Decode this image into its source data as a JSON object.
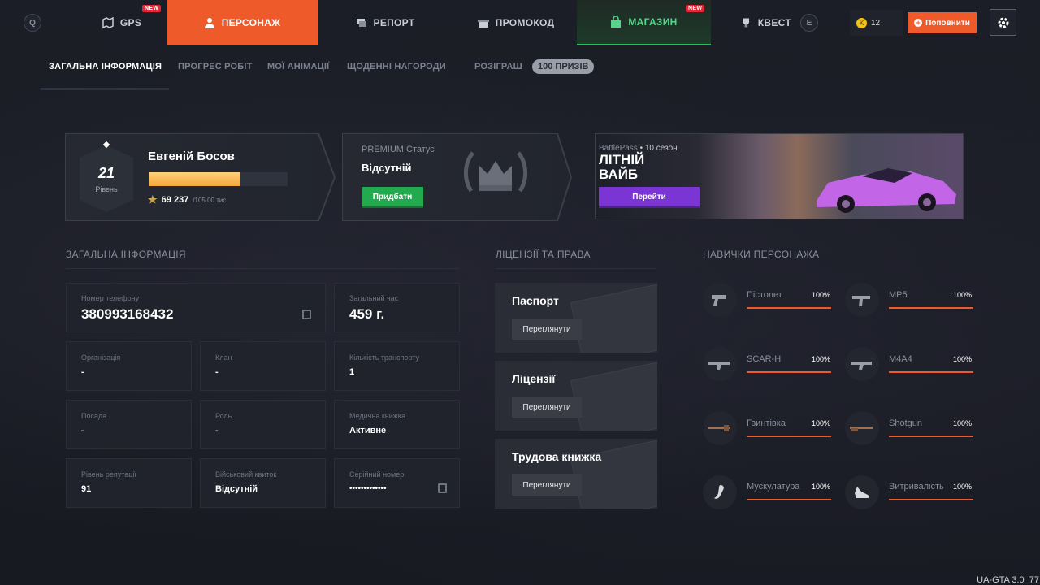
{
  "topnav": {
    "key_left": "Q",
    "key_right": "E",
    "tabs": [
      {
        "label": "GPS",
        "icon": "map-icon",
        "badge": "NEW"
      },
      {
        "label": "ПЕРСОНАЖ",
        "icon": "user-icon",
        "active": true
      },
      {
        "label": "РЕПОРТ",
        "icon": "chat-icon"
      },
      {
        "label": "ПРОМОКОД",
        "icon": "gift-icon"
      },
      {
        "label": "МАГАЗИН",
        "icon": "bag-icon",
        "badge": "NEW"
      },
      {
        "label": "КВЕСТ",
        "icon": "trophy-icon"
      }
    ],
    "coins": "12",
    "coin_symbol": "K",
    "topup_label": "Поповнити"
  },
  "subtabs": {
    "items": [
      "ЗАГАЛЬНА ІНФОРМАЦІЯ",
      "ПРОГРЕС РОБІТ",
      "МОЇ АНІМАЦІЇ",
      "ЩОДЕННІ НАГОРОДИ",
      "РОЗІГРАШ"
    ],
    "prize_badge": "100 ПРИЗІВ"
  },
  "profile": {
    "level": "21",
    "level_label": "Рівень",
    "name": "Евгеній Босов",
    "xp_current": "69 237",
    "xp_max": "/105.00 тис.",
    "xp_fraction": 0.66
  },
  "premium": {
    "title": "PREMIUM Статус",
    "status": "Відсутній",
    "button": "Придбати"
  },
  "battlepass": {
    "label": "BattlePass",
    "season": "10 сезон",
    "title_line1": "ЛІТНІЙ",
    "title_line2": "ВАЙБ",
    "button": "Перейти"
  },
  "general": {
    "header": "ЗАГАЛЬНА ІНФОРМАЦІЯ",
    "phone_label": "Номер телефону",
    "phone": "380993168432",
    "time_label": "Загальний час",
    "time": "459 г.",
    "org_label": "Організація",
    "org": "-",
    "clan_label": "Клан",
    "clan": "-",
    "transport_label": "Кількість транспорту",
    "transport": "1",
    "post_label": "Посада",
    "post": "-",
    "role_label": "Роль",
    "role": "-",
    "med_label": "Медична книжка",
    "med": "Активне",
    "rep_label": "Рівень репутації",
    "rep": "91",
    "military_label": "Військовий квиток",
    "military": "Відсутній",
    "serial_label": "Серійний номер",
    "serial": "•••••••••••••"
  },
  "licenses": {
    "header": "ЛІЦЕНЗІЇ ТА ПРАВА",
    "items": [
      {
        "title": "Паспорт",
        "button": "Переглянути"
      },
      {
        "title": "Ліцензії",
        "button": "Переглянути"
      },
      {
        "title": "Трудова книжка",
        "button": "Переглянути"
      }
    ]
  },
  "skills": {
    "header": "НАВИЧКИ ПЕРСОНАЖА",
    "items": [
      {
        "name": "Пістолет",
        "pct": "100%",
        "icon": "pistol-icon"
      },
      {
        "name": "MP5",
        "pct": "100%",
        "icon": "smg-icon"
      },
      {
        "name": "SCAR-H",
        "pct": "100%",
        "icon": "rifle-icon"
      },
      {
        "name": "M4A4",
        "pct": "100%",
        "icon": "rifle-icon"
      },
      {
        "name": "Гвинтівка",
        "pct": "100%",
        "icon": "sniper-icon"
      },
      {
        "name": "Shotgun",
        "pct": "100%",
        "icon": "shotgun-icon"
      },
      {
        "name": "Мускулатура",
        "pct": "100%",
        "icon": "muscle-icon"
      },
      {
        "name": "Витривалість",
        "pct": "100%",
        "icon": "shoe-icon"
      }
    ]
  },
  "footer": {
    "version": "UA-GTA 3.0",
    "extra": "77"
  },
  "colors": {
    "accent": "#ef5a2a",
    "green": "#23a94e",
    "purple": "#7a35d4"
  }
}
